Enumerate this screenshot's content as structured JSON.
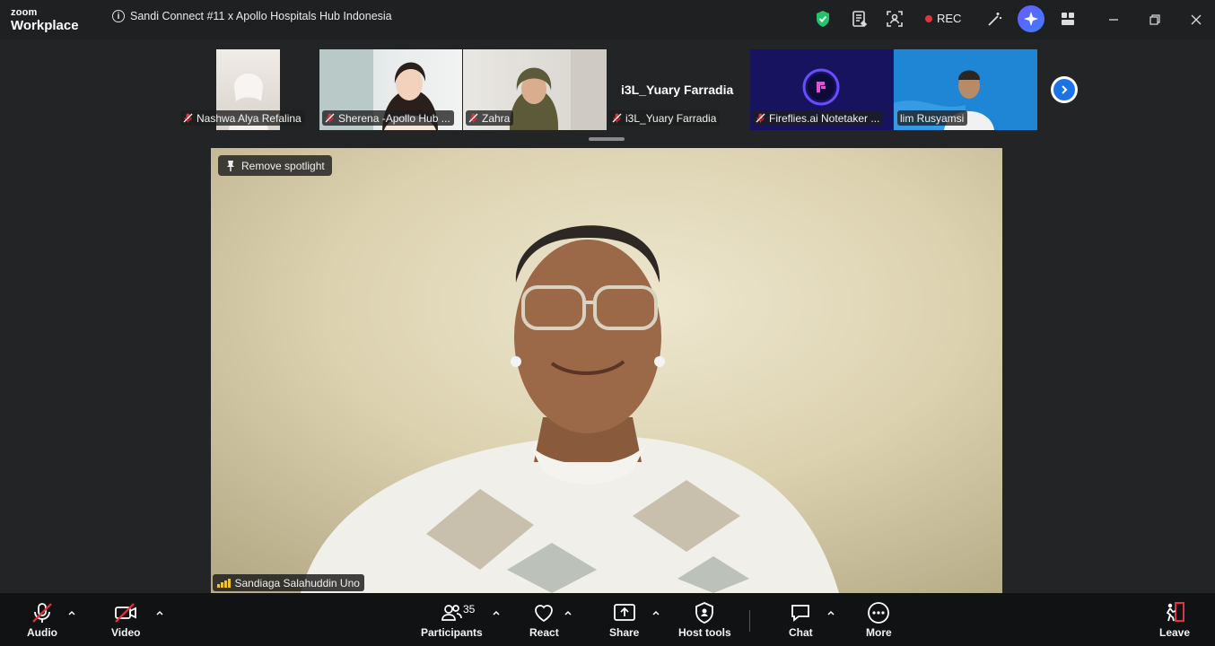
{
  "app": {
    "logo_small": "zoom",
    "logo_big": "Workplace"
  },
  "meeting": {
    "title": "Sandi Connect #11 x Apollo Hospitals Hub Indonesia"
  },
  "titlebar": {
    "rec_label": "REC",
    "shield_color": "#23c26b",
    "rec_color": "#e0353f"
  },
  "gallery": {
    "participants": [
      {
        "name": "Nashwa Alya Refalina",
        "muted": true
      },
      {
        "name": "Sherena -Apollo Hub ...",
        "muted": true
      },
      {
        "name": "Zahra",
        "muted": true
      },
      {
        "name": "i3L_Yuary Farradia",
        "muted": true,
        "display_name": "i3L_Yuary Farradia"
      },
      {
        "name": "Fireflies.ai Notetaker ...",
        "muted": true
      },
      {
        "name": "lim Rusyamsi",
        "muted": false
      }
    ]
  },
  "stage": {
    "spotlight_label": "Remove spotlight",
    "speaker_name": "Sandiaga Salahuddin Uno"
  },
  "toolbar": {
    "audio": "Audio",
    "video": "Video",
    "participants": "Participants",
    "participant_count": "35",
    "react": "React",
    "share": "Share",
    "host_tools": "Host tools",
    "chat": "Chat",
    "more": "More",
    "leave": "Leave",
    "leave_color": "#e0353f"
  }
}
